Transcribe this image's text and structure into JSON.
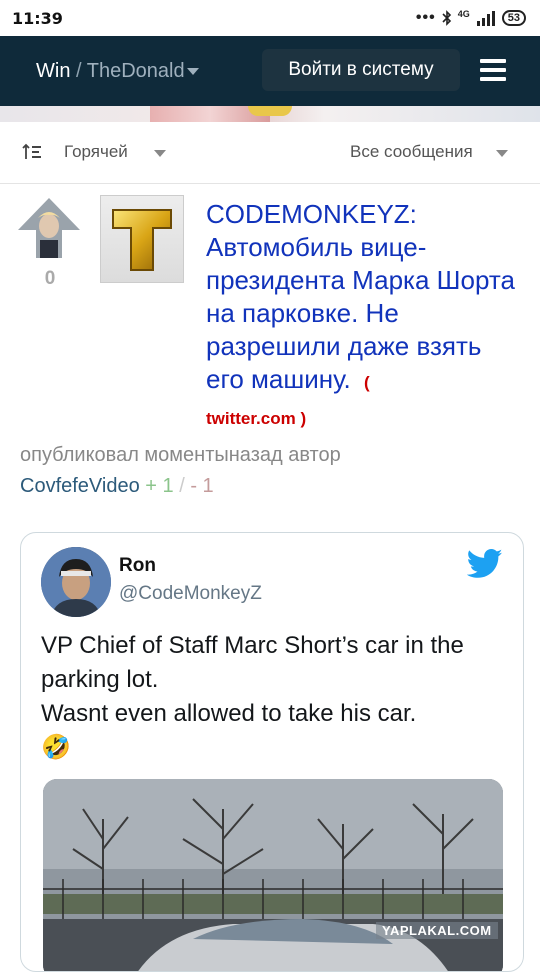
{
  "status_bar": {
    "time": "11:39",
    "icons": [
      "more-dots-icon",
      "bluetooth-icon",
      "4g-signal-icon"
    ],
    "network": "4G",
    "battery": "53"
  },
  "header": {
    "site": "Win",
    "separator": " / ",
    "community": "TheDonald",
    "login_label": "Войти в систему",
    "colors": {
      "background": "#0f2a3a",
      "button": "#1d3340"
    }
  },
  "sort_bar": {
    "sort_label": "Горячей",
    "filter_label": "Все сообщения"
  },
  "post": {
    "score": "0",
    "thumbnail_letter": "T",
    "title": "CODEMONKEYZ: Автомобиль вице-президента Марка Шорта на парковке. Не разрешили даже взять его машину.",
    "domain_open": "(",
    "domain": "twitter.com",
    "domain_close": ")",
    "meta_prefix": "опубликовал моментыназад автор",
    "author": "CovfefeVideo",
    "plus": "+ 1",
    "slash": "/",
    "minus": "- 1",
    "colors": {
      "title": "#1133bb",
      "domain": "#cc0000"
    }
  },
  "tweet": {
    "name": "Ron",
    "handle": "@CodeMonkeyZ",
    "text": "VP Chief of Staff Marc Short’s car in the parking lot.\nWasnt even allowed to take his car.",
    "emoji": "🤣",
    "bird_color": "#1da1f2"
  },
  "watermark": "YAPLAKAL.COM"
}
